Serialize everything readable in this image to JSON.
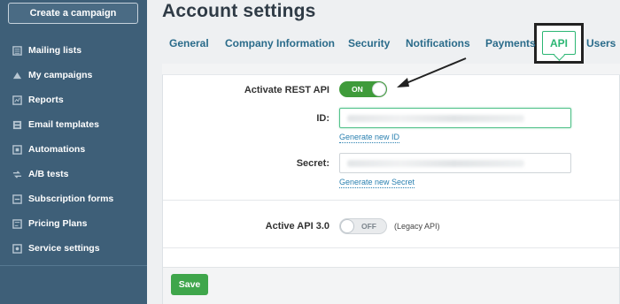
{
  "sidebar": {
    "create_campaign": "Create a campaign",
    "items": [
      {
        "label": "Mailing lists",
        "icon": "list-icon"
      },
      {
        "label": "My campaigns",
        "icon": "campaign-icon"
      },
      {
        "label": "Reports",
        "icon": "reports-icon"
      },
      {
        "label": "Email templates",
        "icon": "template-icon"
      },
      {
        "label": "Automations",
        "icon": "automation-icon"
      },
      {
        "label": "A/B tests",
        "icon": "ab-test-icon"
      },
      {
        "label": "Subscription forms",
        "icon": "form-icon"
      },
      {
        "label": "Pricing Plans",
        "icon": "pricing-icon"
      },
      {
        "label": "Service settings",
        "icon": "settings-icon"
      }
    ]
  },
  "page": {
    "title": "Account settings",
    "tabs": [
      "General",
      "Company Information",
      "Security",
      "Notifications",
      "Payments",
      "API",
      "Users"
    ],
    "active_tab": "API"
  },
  "form": {
    "rest_api_label": "Activate REST API",
    "rest_api_toggle": "ON",
    "id_label": "ID:",
    "generate_id": "Generate new ID",
    "secret_label": "Secret:",
    "generate_secret": "Generate new Secret",
    "api3_label": "Active API 3.0",
    "api3_toggle": "OFF",
    "api3_note": "(Legacy API)",
    "save": "Save"
  },
  "colors": {
    "sidebar_bg": "#3e5f78",
    "accent_green": "#3f9b3a",
    "link_blue": "#2a80b0"
  }
}
